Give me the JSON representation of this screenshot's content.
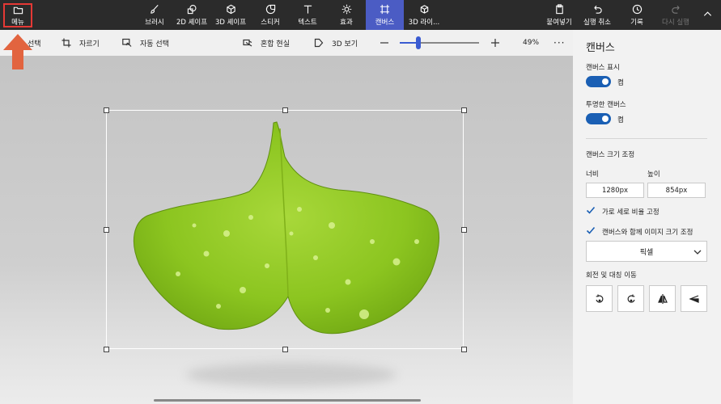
{
  "topbar": {
    "menu_label": "메뉴",
    "tools": [
      {
        "label": "브러시",
        "icon": "brush-icon"
      },
      {
        "label": "2D 셰이프",
        "icon": "2d-shapes-icon"
      },
      {
        "label": "3D 셰이프",
        "icon": "3d-shapes-icon"
      },
      {
        "label": "스티커",
        "icon": "sticker-icon"
      },
      {
        "label": "텍스트",
        "icon": "text-icon"
      },
      {
        "label": "효과",
        "icon": "effects-icon"
      },
      {
        "label": "캔버스",
        "icon": "canvas-icon"
      },
      {
        "label": "3D 라이...",
        "icon": "3d-library-icon"
      }
    ],
    "actions": {
      "paste": "붙여넣기",
      "undo": "실행 취소",
      "history": "기록",
      "redo": "다시 실행"
    }
  },
  "subbar": {
    "select_label": "선택",
    "crop_label": "자르기",
    "magic_select_label": "자동 선택",
    "mixed_reality_label": "혼합 현실",
    "view3d_label": "3D 보기",
    "zoom_percent": "49%",
    "zoom_slider_fraction": 0.23
  },
  "panel": {
    "title": "캔버스",
    "show_canvas_label": "캔버스 표시",
    "show_canvas_state": "켬",
    "transparent_canvas_label": "투명한 캔버스",
    "transparent_canvas_state": "켬",
    "resize_heading": "캔버스 크기 조정",
    "width_label": "너비",
    "height_label": "높이",
    "width_value": "1280px",
    "height_value": "854px",
    "lock_aspect_label": "가로 세로 비율 고정",
    "resize_image_label": "캔버스와 함께 이미지 크기 조정",
    "unit_value": "픽셀",
    "rotate_heading": "회전 및 대칭 이동"
  },
  "colors": {
    "accent": "#4b5cc4",
    "toggle_on": "#1a5fb4",
    "highlight": "#e53935"
  }
}
